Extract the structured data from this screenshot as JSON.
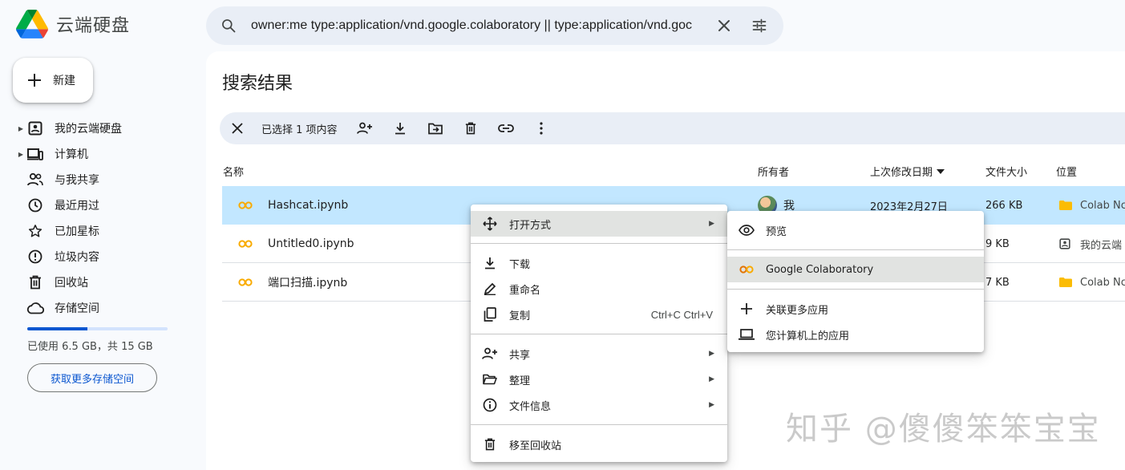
{
  "app": {
    "title": "云端硬盘"
  },
  "search": {
    "query": "owner:me type:application/vnd.google.colaboratory || type:application/vnd.goc"
  },
  "sidebar": {
    "new_label": "新建",
    "items": [
      {
        "label": "我的云端硬盘",
        "icon": "my-drive-icon",
        "expandable": true
      },
      {
        "label": "计算机",
        "icon": "computers-icon",
        "expandable": true
      },
      {
        "label": "与我共享",
        "icon": "shared-with-me-icon",
        "expandable": false
      },
      {
        "label": "最近用过",
        "icon": "recent-icon",
        "expandable": false
      },
      {
        "label": "已加星标",
        "icon": "starred-icon",
        "expandable": false
      },
      {
        "label": "垃圾内容",
        "icon": "spam-icon",
        "expandable": false
      },
      {
        "label": "回收站",
        "icon": "trash-icon",
        "expandable": false
      },
      {
        "label": "存储空间",
        "icon": "cloud-icon",
        "expandable": false
      }
    ],
    "storage": {
      "used_text": "已使用 6.5 GB，共 15 GB",
      "used_fraction": 0.43,
      "button_label": "获取更多存储空间"
    }
  },
  "main": {
    "title": "搜索结果",
    "selection_text": "已选择 1 项内容",
    "columns": {
      "name": "名称",
      "owner": "所有者",
      "modified": "上次修改日期",
      "size": "文件大小",
      "location": "位置"
    },
    "files": [
      {
        "name": "Hashcat.ipynb",
        "owner": "我",
        "modified": "2023年2月27日",
        "size": "266 KB",
        "location": "Colab Nc",
        "selected": true
      },
      {
        "name": "Untitled0.ipynb",
        "owner": "",
        "modified": "",
        "size": "9 KB",
        "location": "我的云端",
        "selected": false
      },
      {
        "name": "端口扫描.ipynb",
        "owner": "",
        "modified": "",
        "size": "7 KB",
        "location": "Colab Nc",
        "selected": false
      }
    ]
  },
  "context_menu": {
    "open_with": "打开方式",
    "download": "下载",
    "rename": "重命名",
    "copy": "复制",
    "copy_shortcut": "Ctrl+C Ctrl+V",
    "share": "共享",
    "organize": "整理",
    "file_info": "文件信息",
    "move_to_trash": "移至回收站"
  },
  "submenu": {
    "preview": "预览",
    "colab": "Google Colaboratory",
    "connect_more": "关联更多应用",
    "computer_apps": "您计算机上的应用"
  },
  "watermark": "知乎 @傻傻笨笨宝宝",
  "colors": {
    "accent": "#0b57d0",
    "selected_row": "#c2e7ff",
    "colab_orange": "#f9ab00"
  }
}
